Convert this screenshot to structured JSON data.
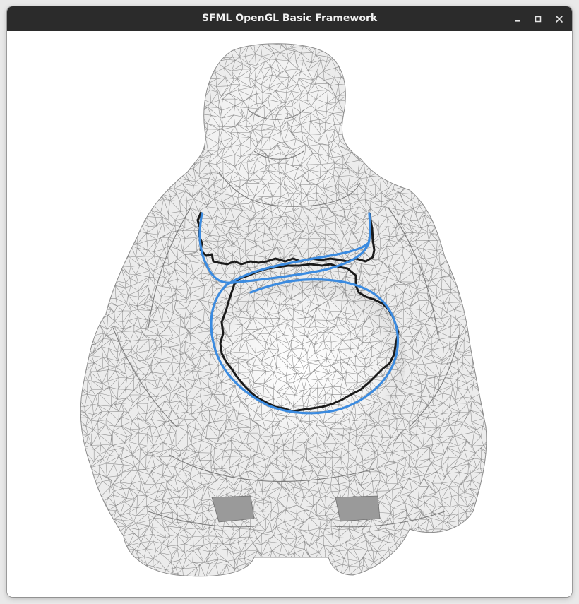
{
  "window": {
    "title": "SFML OpenGL Basic Framework",
    "controls": {
      "minimize": "minimize-icon",
      "maximize": "maximize-icon",
      "close": "close-icon"
    }
  },
  "scene": {
    "model": "buddha statue wireframe mesh",
    "colors": {
      "background": "#ffffff",
      "mesh_fill": "#ececec",
      "wire": "#8c8c8c",
      "shadow": "#9a9a9a",
      "curve_black": "#1a1a1a",
      "curve_blue": "#3b8be0"
    }
  }
}
